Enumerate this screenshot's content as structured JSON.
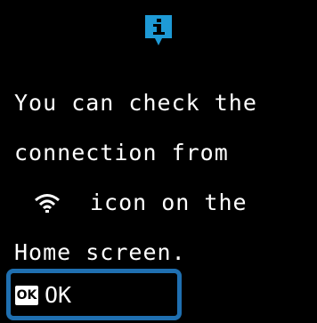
{
  "colors": {
    "background": "#000000",
    "text": "#ffffff",
    "info_icon": "#1e9ad6",
    "button_border": "#1f6fb0"
  },
  "header": {
    "icon": "info-icon",
    "icon_glyph": "i"
  },
  "message": {
    "line1": "You can check the",
    "line2": "connection from",
    "line3_icon": "wifi-icon",
    "line3_text": "icon on the",
    "line4": "Home screen."
  },
  "footer": {
    "button_key": "OK",
    "button_label": "OK"
  }
}
